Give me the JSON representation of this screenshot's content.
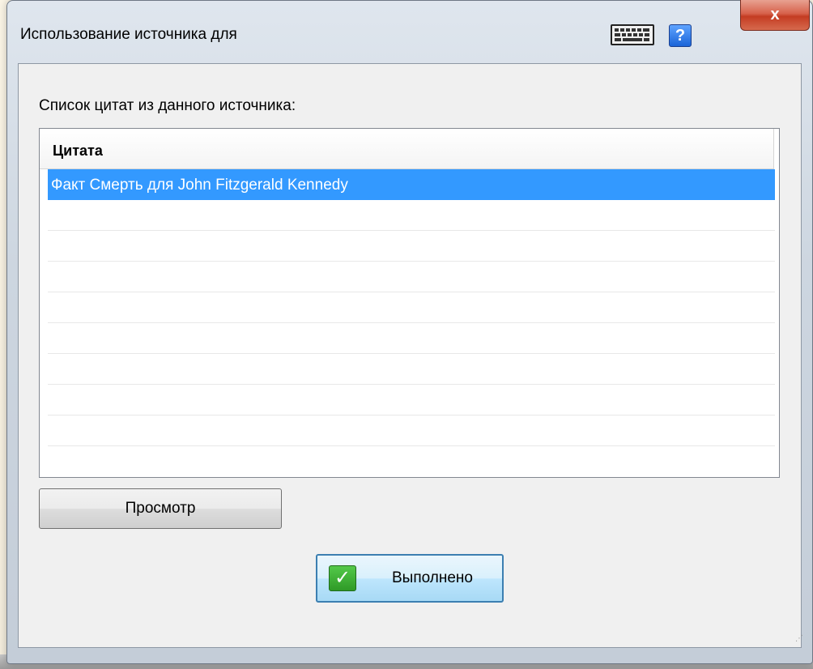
{
  "window": {
    "title": "Использование источника для",
    "close_label": "x",
    "help_label": "?"
  },
  "icons": {
    "keyboard": "keyboard-icon",
    "help": "help-icon",
    "close": "close-icon",
    "check": "checkmark-icon"
  },
  "list": {
    "label": "Список цитат из данного источника:",
    "column_header": "Цитата",
    "rows": [
      {
        "text": "Факт Смерть для John Fitzgerald Kennedy",
        "selected": true
      }
    ]
  },
  "buttons": {
    "preview_label": "Просмотр",
    "done_label": "Выполнено"
  },
  "colors": {
    "selection": "#3399ff",
    "close_button": "#c43c22",
    "check_green": "#2f9a27"
  }
}
